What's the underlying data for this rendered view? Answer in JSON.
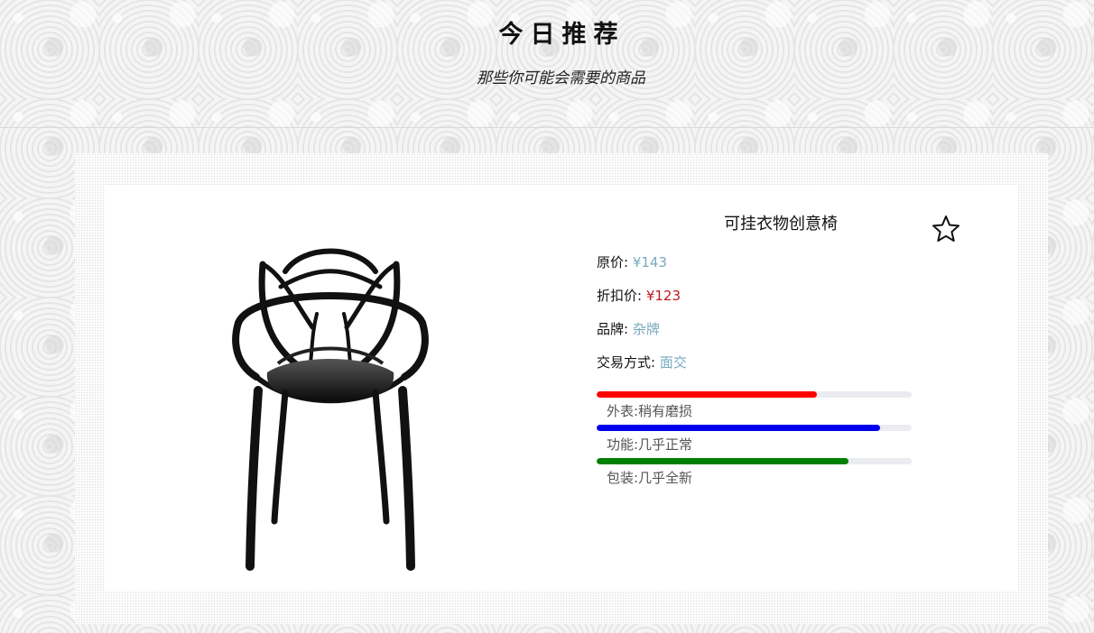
{
  "header": {
    "title": "今日推荐",
    "subtitle": "那些你可能会需要的商品"
  },
  "product": {
    "name": "可挂衣物创意椅",
    "image_icon": "chair-icon",
    "favorite_icon": "star-outline-icon",
    "original_price_label": "原价:",
    "original_price": "¥143",
    "discount_price_label": "折扣价:",
    "discount_price": "¥123",
    "brand_label": "品牌:",
    "brand": "杂牌",
    "trade_label": "交易方式:",
    "trade": "面交"
  },
  "conditions": [
    {
      "label": "外表:稍有磨损",
      "level_percent": 70,
      "color": "#ff0000"
    },
    {
      "label": "功能:几乎正常",
      "level_percent": 90,
      "color": "#0000ee"
    },
    {
      "label": "包装:几乎全新",
      "level_percent": 80,
      "color": "#008000"
    }
  ],
  "colors": {
    "price_value": "#7aaabe",
    "discount_value": "#b91c1c",
    "track": "#ebebf2"
  }
}
